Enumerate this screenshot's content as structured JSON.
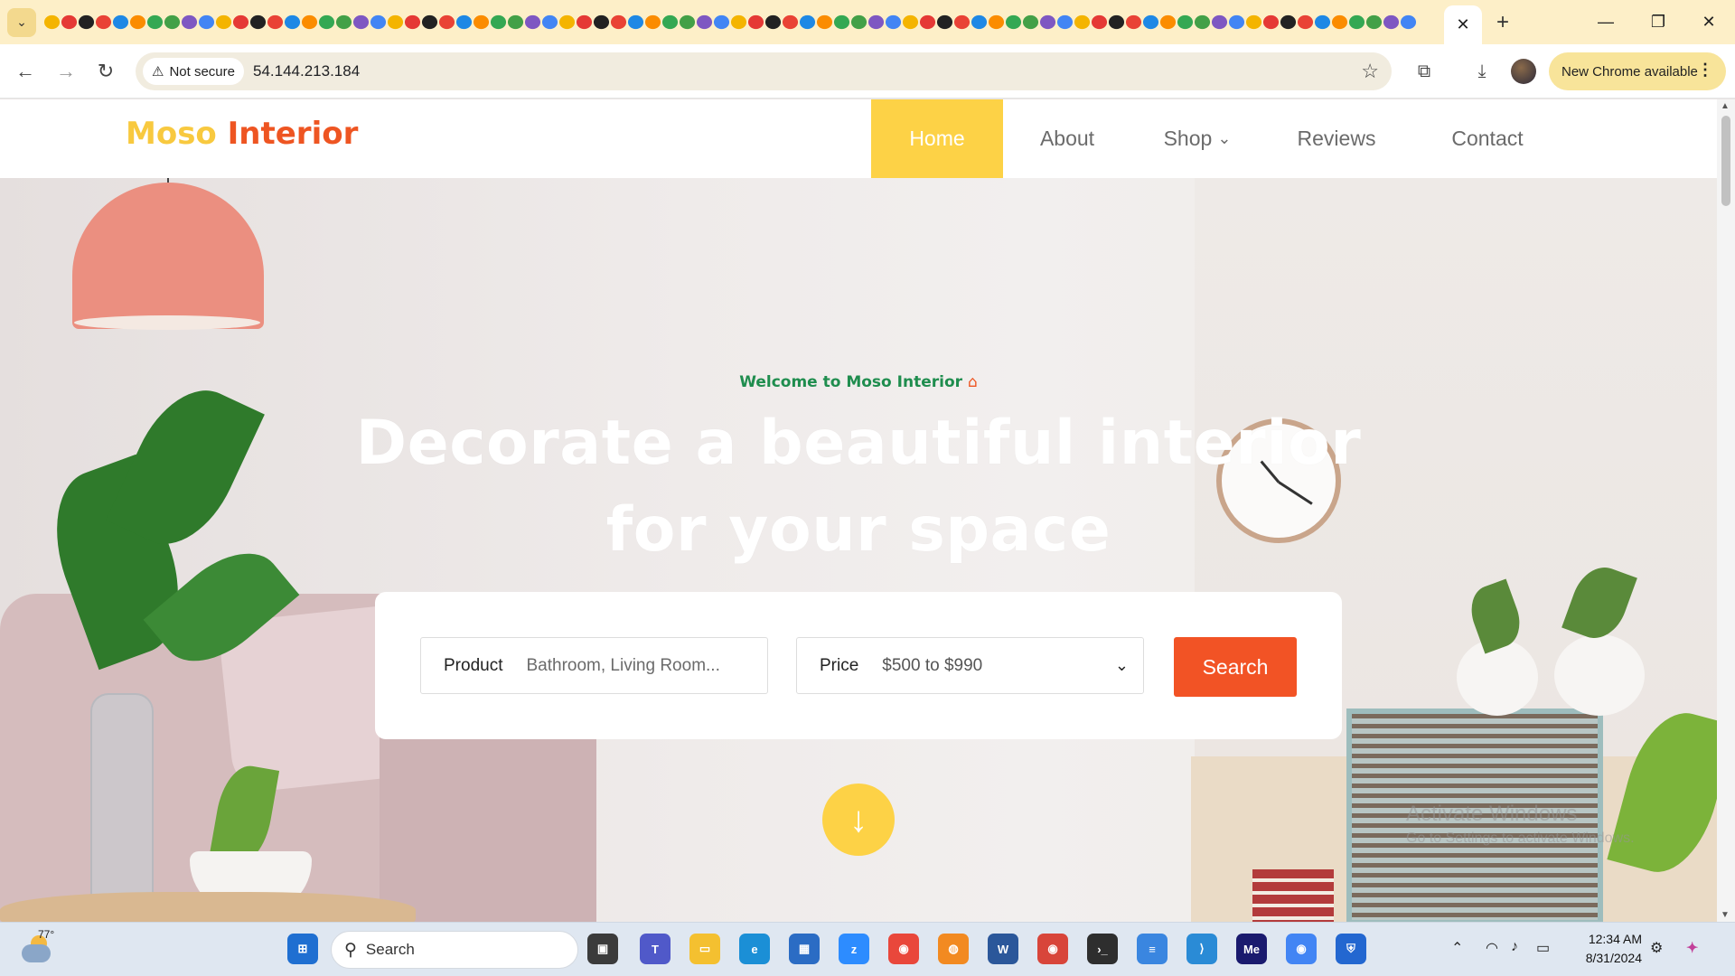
{
  "browser": {
    "active_tab_close": "✕",
    "new_tab": "+",
    "address": {
      "security_label": "Not secure",
      "url": "54.144.213.184"
    },
    "update_label": "New Chrome available"
  },
  "site": {
    "logo": {
      "word1": "Moso",
      "word2": "Interior"
    },
    "nav": [
      {
        "label": "Home",
        "active": true
      },
      {
        "label": "About",
        "active": false
      },
      {
        "label": "Shop",
        "active": false,
        "has_dropdown": true
      },
      {
        "label": "Reviews",
        "active": false
      },
      {
        "label": "Contact",
        "active": false
      }
    ],
    "hero": {
      "subtitle": "Welcome to Moso Interior",
      "title_line1": "Decorate a beautiful interior",
      "title_line2": "for your space"
    },
    "search": {
      "product_label": "Product",
      "product_placeholder": "Bathroom, Living Room...",
      "price_label": "Price",
      "price_value": "$500 to $990",
      "button_label": "Search"
    },
    "watermark": {
      "line1": "Activate Windows",
      "line2": "Go to Settings to activate Windows."
    }
  },
  "taskbar": {
    "weather_temp": "77°",
    "search_placeholder": "Search",
    "time": "12:34 AM",
    "date": "8/31/2024"
  },
  "colors": {
    "brand_yellow": "#fdd246",
    "brand_orange": "#f25325",
    "brand_green": "#1f8d4e"
  }
}
